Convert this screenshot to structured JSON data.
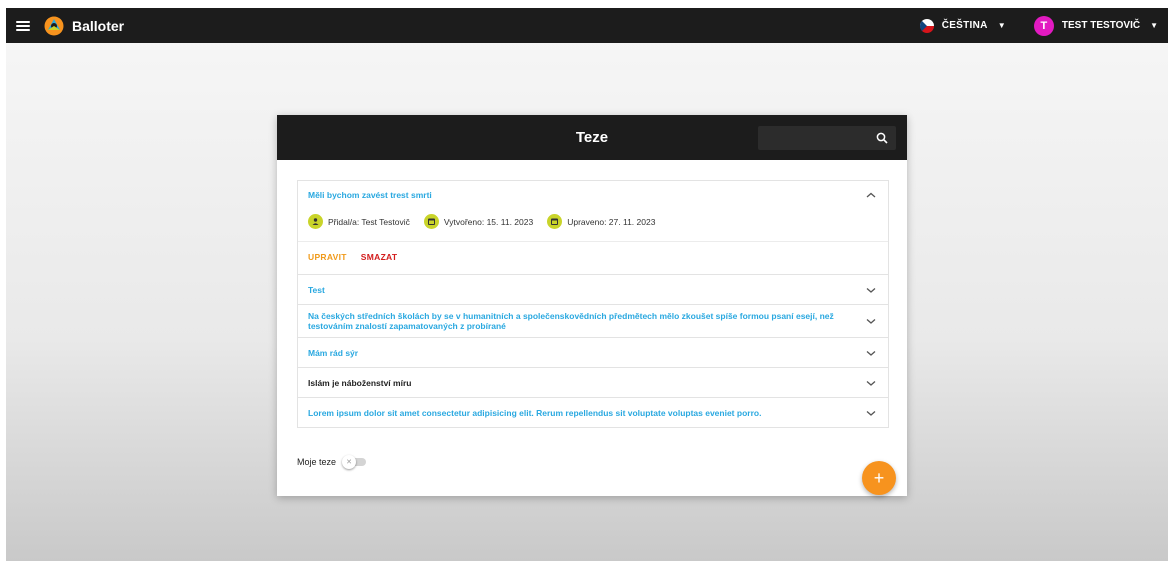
{
  "appbar": {
    "title": "Balloter",
    "language": "ČEŠTINA",
    "user_initial": "T",
    "user_name": "TEST TESTOVIČ"
  },
  "panel": {
    "title": "Teze",
    "search_placeholder": ""
  },
  "theses": [
    {
      "title": "Měli bychom zavést trest smrti",
      "expanded": true,
      "author_label": "Přidal/a: Test Testovič",
      "created_label": "Vytvořeno: 15. 11. 2023",
      "updated_label": "Upraveno: 27. 11. 2023",
      "edit_label": "UPRAVIT",
      "delete_label": "SMAZAT"
    },
    {
      "title": "Test"
    },
    {
      "title": "Na českých středních školách by se v humanitních a společenskovědních předmětech mělo zkoušet spíše formou psaní esejí, než testováním znalostí zapamatovaných z probírané"
    },
    {
      "title": "Mám rád sýr"
    },
    {
      "title": "Islám je náboženství míru"
    },
    {
      "title": "Lorem ipsum dolor sit amet consectetur adipisicing elit. Rerum repellendus sit voluptate voluptas eveniet porro."
    }
  ],
  "footer": {
    "my_theses_label": "Moje teze",
    "my_theses_toggle_off": true,
    "add_label": "+"
  },
  "colors": {
    "link": "#29a8e0",
    "accent": "#f7931e",
    "delete": "#d31b1b",
    "chip": "#c9d42a",
    "avatar": "#e21ac1"
  }
}
